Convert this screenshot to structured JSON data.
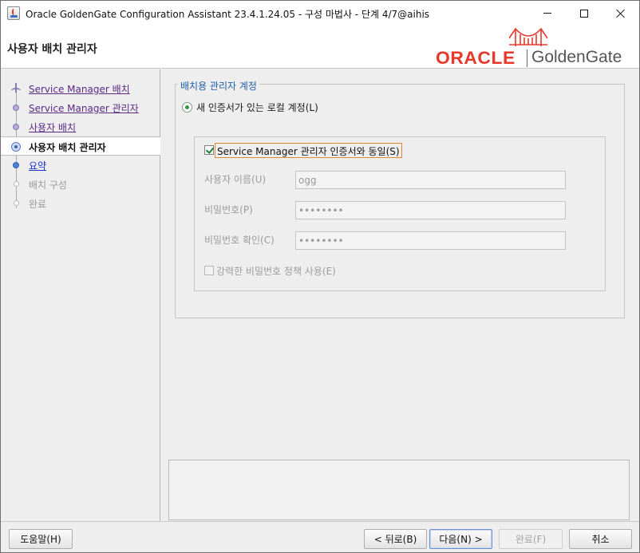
{
  "window": {
    "title": "Oracle GoldenGate Configuration Assistant 23.4.1.24.05 - 구성 마법사 - 단계 4/7@aihis",
    "app_icon": "java-coffee-icon"
  },
  "header": {
    "page_title": "사용자 배치 관리자",
    "logo_brand": "ORACLE",
    "logo_product": "GoldenGate",
    "logo_color": "#e8382a"
  },
  "nav": {
    "items": [
      {
        "label": "Service Manager 배치",
        "state": "visited"
      },
      {
        "label": "Service Manager 관리자",
        "state": "visited"
      },
      {
        "label": "사용자 배치",
        "state": "visited"
      },
      {
        "label": "사용자 배치 관리자",
        "state": "current"
      },
      {
        "label": "요약",
        "state": "next"
      },
      {
        "label": "배치 구성",
        "state": "future"
      },
      {
        "label": "완료",
        "state": "future"
      }
    ]
  },
  "form": {
    "group_title": "배치용 관리자 계정",
    "radio_local": "새 인증서가 있는 로컬 계정(L)",
    "same_as_sm_checkbox": "Service Manager 관리자 인증서와 동일(S)",
    "same_as_sm_checked": true,
    "username_label": "사용자 이름(U)",
    "username_value": "ogg",
    "password_label": "비밀번호(P)",
    "password_value": "••••••••",
    "confirm_label": "비밀번호 확인(C)",
    "confirm_value": "••••••••",
    "strong_policy_checkbox": "강력한 비밀번호 정책 사용(E)",
    "strong_policy_checked": false
  },
  "buttons": {
    "help": "도움말(H)",
    "back": "< 뒤로(B)",
    "next": "다음(N) >",
    "finish": "완료(F)",
    "cancel": "취소"
  }
}
